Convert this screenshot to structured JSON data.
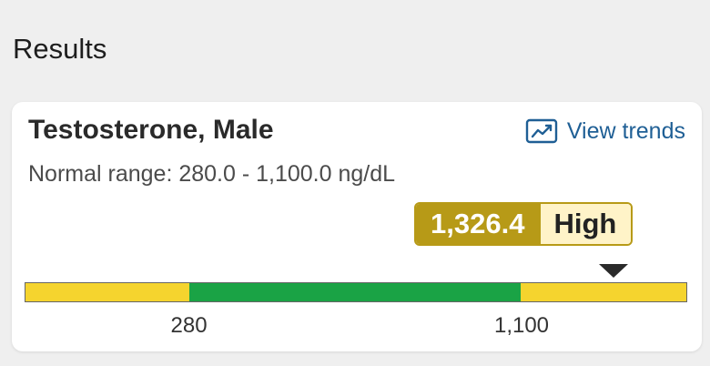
{
  "page": {
    "heading": "Results"
  },
  "card": {
    "test_name": "Testosterone, Male",
    "trends_label": "View trends",
    "trends_icon": "trend-chart-icon",
    "normal_range_text": "Normal range: 280.0 - 1,100.0 ng/dL"
  },
  "result": {
    "value": "1,326.4",
    "flag": "High",
    "numeric_value": 1326.4,
    "colors": {
      "value_bg": "#b79a17",
      "flag_bg": "#fff3c8"
    }
  },
  "range_bar": {
    "low": 280,
    "high": 1100,
    "low_label": "280",
    "high_label": "1,100",
    "unit": "ng/dL",
    "colors": {
      "out_of_range": "#f5d42e",
      "in_range": "#1aa345"
    }
  }
}
